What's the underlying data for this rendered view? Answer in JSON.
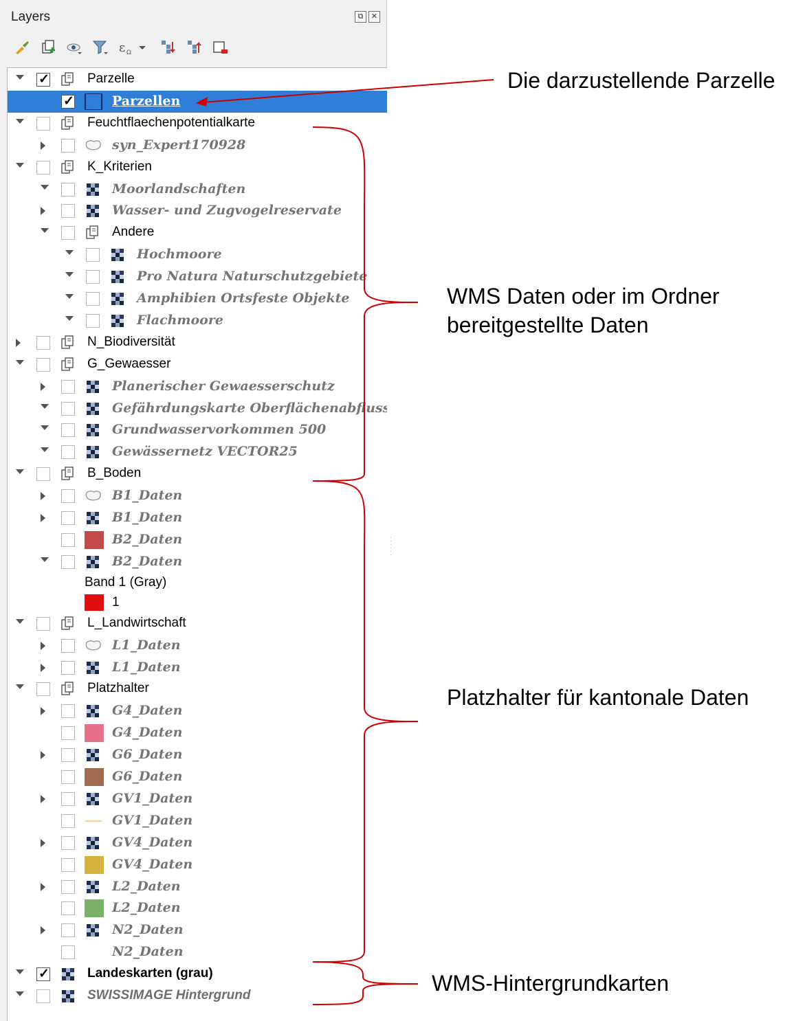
{
  "panel": {
    "title": "Layers",
    "toolbar_icons": [
      "style-manager-icon",
      "add-group-icon",
      "visibility-icon",
      "filter-legend-icon",
      "filter-expression-icon",
      "expand-all-icon",
      "collapse-all-icon",
      "remove-layer-icon"
    ]
  },
  "tree": [
    {
      "level": 0,
      "arrow": "down",
      "checked": true,
      "icon": "group",
      "label": "Parzelle",
      "style": "group"
    },
    {
      "level": 1,
      "arrow": "none",
      "checked": true,
      "icon": "polygon-outline",
      "label": "Parzellen",
      "style": "selected",
      "selected": true
    },
    {
      "level": 0,
      "arrow": "down",
      "checked": false,
      "icon": "group",
      "label": "Feuchtflaechenpotentialkarte",
      "style": "group"
    },
    {
      "level": 1,
      "arrow": "right",
      "checked": false,
      "icon": "polygon-gray",
      "label": "syn_Expert170928",
      "style": "layer"
    },
    {
      "level": 0,
      "arrow": "down",
      "checked": false,
      "icon": "group",
      "label": "K_Kriterien",
      "style": "group"
    },
    {
      "level": 1,
      "arrow": "down",
      "checked": false,
      "icon": "raster",
      "label": "Moorlandschaften",
      "style": "layer"
    },
    {
      "level": 1,
      "arrow": "right",
      "checked": false,
      "icon": "raster",
      "label": "Wasser- und Zugvogelreservate",
      "style": "layer"
    },
    {
      "level": 1,
      "arrow": "down",
      "checked": false,
      "icon": "group",
      "label": "Andere",
      "style": "group"
    },
    {
      "level": 2,
      "arrow": "down",
      "checked": false,
      "icon": "raster",
      "label": "Hochmoore",
      "style": "layer"
    },
    {
      "level": 2,
      "arrow": "down",
      "checked": false,
      "icon": "raster",
      "label": "Pro Natura Naturschutzgebiete",
      "style": "layer"
    },
    {
      "level": 2,
      "arrow": "down",
      "checked": false,
      "icon": "raster",
      "label": "Amphibien Ortsfeste Objekte",
      "style": "layer"
    },
    {
      "level": 2,
      "arrow": "down",
      "checked": false,
      "icon": "raster",
      "label": "Flachmoore",
      "style": "layer"
    },
    {
      "level": 0,
      "arrow": "right",
      "checked": false,
      "icon": "group",
      "label": "N_Biodiversität",
      "style": "group"
    },
    {
      "level": 0,
      "arrow": "down",
      "checked": false,
      "icon": "group",
      "label": "G_Gewaesser",
      "style": "group"
    },
    {
      "level": 1,
      "arrow": "right",
      "checked": false,
      "icon": "raster",
      "label": "Planerischer Gewaesserschutz",
      "style": "layer"
    },
    {
      "level": 1,
      "arrow": "down",
      "checked": false,
      "icon": "raster",
      "label": "Gefährdungskarte Oberflächenabfluss",
      "style": "layer"
    },
    {
      "level": 1,
      "arrow": "down",
      "checked": false,
      "icon": "raster",
      "label": "Grundwasservorkommen 500",
      "style": "layer"
    },
    {
      "level": 1,
      "arrow": "down",
      "checked": false,
      "icon": "raster",
      "label": "Gewässernetz VECTOR25",
      "style": "layer"
    },
    {
      "level": 0,
      "arrow": "down",
      "checked": false,
      "icon": "group",
      "label": "B_Boden",
      "style": "group"
    },
    {
      "level": 1,
      "arrow": "right",
      "checked": false,
      "icon": "polygon-gray",
      "label": "B1_Daten",
      "style": "layer"
    },
    {
      "level": 1,
      "arrow": "right",
      "checked": false,
      "icon": "raster",
      "label": "B1_Daten",
      "style": "layer"
    },
    {
      "level": 1,
      "arrow": "none",
      "checked": false,
      "icon": "swatch",
      "swatch": "#c24a4a",
      "label": "B2_Daten",
      "style": "layer"
    },
    {
      "level": 1,
      "arrow": "down",
      "checked": false,
      "icon": "raster",
      "label": "B2_Daten",
      "style": "layer"
    },
    {
      "level": 1,
      "arrow": "none",
      "checked": null,
      "icon": "none",
      "label": "Band 1 (Gray)",
      "style": "legend",
      "compact": true
    },
    {
      "level": 1,
      "arrow": "none",
      "checked": null,
      "icon": "swatch",
      "swatch": "#e01010",
      "label": "1",
      "style": "legend",
      "compact": true
    },
    {
      "level": 0,
      "arrow": "down",
      "checked": false,
      "icon": "group",
      "label": "L_Landwirtschaft",
      "style": "group"
    },
    {
      "level": 1,
      "arrow": "right",
      "checked": false,
      "icon": "polygon-gray",
      "label": "L1_Daten",
      "style": "layer"
    },
    {
      "level": 1,
      "arrow": "right",
      "checked": false,
      "icon": "raster",
      "label": "L1_Daten",
      "style": "layer"
    },
    {
      "level": 0,
      "arrow": "down",
      "checked": false,
      "icon": "group",
      "label": "Platzhalter",
      "style": "group"
    },
    {
      "level": 1,
      "arrow": "right",
      "checked": false,
      "icon": "raster",
      "label": "G4_Daten",
      "style": "layer"
    },
    {
      "level": 1,
      "arrow": "none",
      "checked": false,
      "icon": "swatch",
      "swatch": "#e6708a",
      "label": "G4_Daten",
      "style": "layer"
    },
    {
      "level": 1,
      "arrow": "right",
      "checked": false,
      "icon": "raster",
      "label": "G6_Daten",
      "style": "layer"
    },
    {
      "level": 1,
      "arrow": "none",
      "checked": false,
      "icon": "swatch",
      "swatch": "#a06a50",
      "label": "G6_Daten",
      "style": "layer"
    },
    {
      "level": 1,
      "arrow": "right",
      "checked": false,
      "icon": "raster",
      "label": "GV1_Daten",
      "style": "layer"
    },
    {
      "level": 1,
      "arrow": "none",
      "checked": false,
      "icon": "line",
      "swatch": "#f2d9a0",
      "label": "GV1_Daten",
      "style": "layer"
    },
    {
      "level": 1,
      "arrow": "right",
      "checked": false,
      "icon": "raster",
      "label": "GV4_Daten",
      "style": "layer"
    },
    {
      "level": 1,
      "arrow": "none",
      "checked": false,
      "icon": "swatch",
      "swatch": "#d4b23c",
      "label": "GV4_Daten",
      "style": "layer"
    },
    {
      "level": 1,
      "arrow": "right",
      "checked": false,
      "icon": "raster",
      "label": "L2_Daten",
      "style": "layer"
    },
    {
      "level": 1,
      "arrow": "none",
      "checked": false,
      "icon": "swatch",
      "swatch": "#7ab068",
      "label": "L2_Daten",
      "style": "layer"
    },
    {
      "level": 1,
      "arrow": "right",
      "checked": false,
      "icon": "raster",
      "label": "N2_Daten",
      "style": "layer"
    },
    {
      "level": 1,
      "arrow": "none",
      "checked": false,
      "icon": "none",
      "label": "N2_Daten",
      "style": "layer"
    },
    {
      "level": 0,
      "arrow": "down",
      "checked": true,
      "icon": "raster",
      "label": "Landeskarten (grau)",
      "style": "boldn"
    },
    {
      "level": 0,
      "arrow": "down",
      "checked": false,
      "icon": "raster",
      "label": "SWISSIMAGE Hintergrund",
      "style": "boldi"
    }
  ],
  "annotations": {
    "parcel": "Die darzustellende Parzelle",
    "wms_line1": "WMS Daten oder im Ordner",
    "wms_line2": "bereitgestellte Daten",
    "placeholder": "Platzhalter für kantonale Daten",
    "background": "WMS-Hintergrundkarten"
  },
  "colors": {
    "selection": "#2f7ed8",
    "annotation_line": "#d00000"
  }
}
